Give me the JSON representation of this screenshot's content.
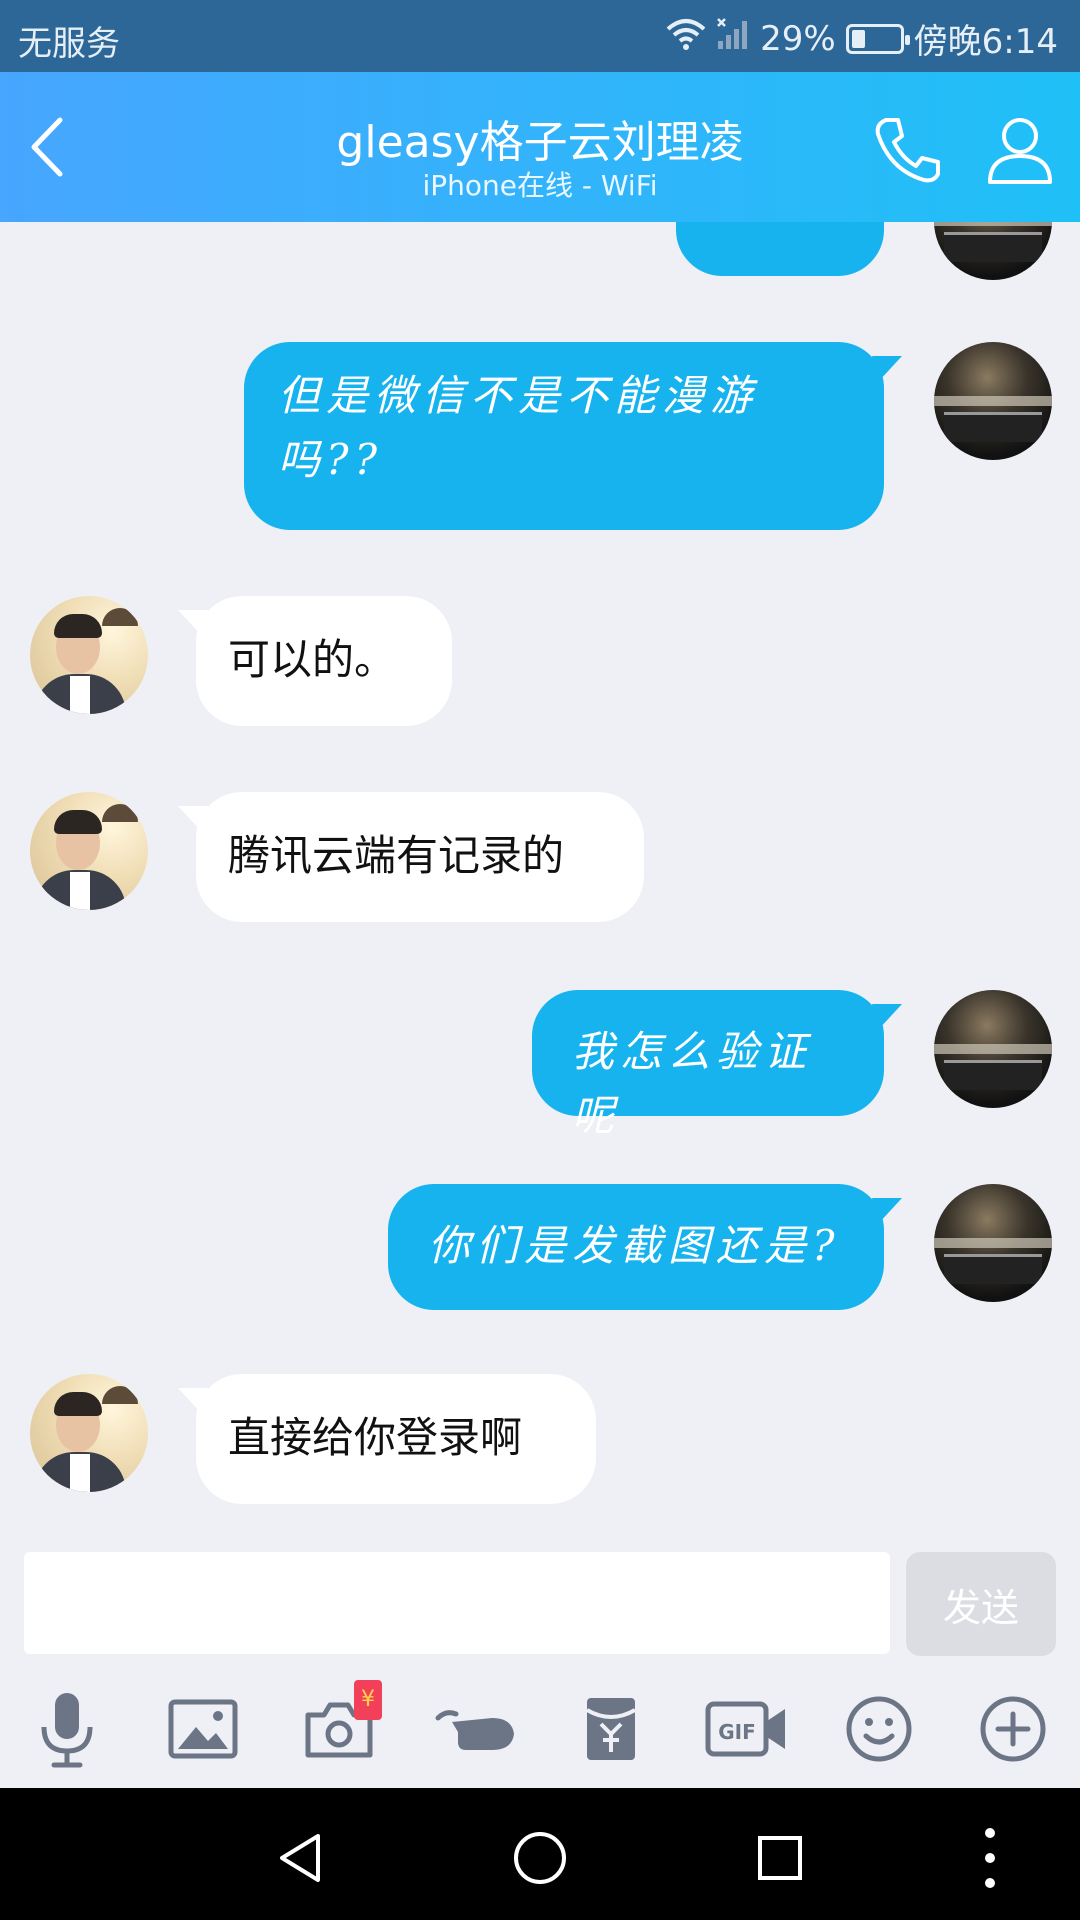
{
  "status_bar": {
    "carrier": "无服务",
    "battery_percent": "29%",
    "battery_level": 0.29,
    "time": "傍晚6:14"
  },
  "header": {
    "title": "gleasy格子云刘理凌",
    "subtitle": "iPhone在线 - WiFi",
    "icons": [
      "back-arrow-icon",
      "phone-icon",
      "profile-icon"
    ]
  },
  "messages": [
    {
      "direction": "out",
      "text": ""
    },
    {
      "direction": "out",
      "text": "但是微信不是不能漫游吗??"
    },
    {
      "direction": "in",
      "text": "可以的。"
    },
    {
      "direction": "in",
      "text": "腾讯云端有记录的"
    },
    {
      "direction": "out",
      "text": "我怎么验证呢"
    },
    {
      "direction": "out",
      "text": "你们是发截图还是?"
    },
    {
      "direction": "in",
      "text": "直接给你登录啊"
    }
  ],
  "composer": {
    "input_value": "",
    "send_label": "发送"
  },
  "toolbar": {
    "items": [
      "microphone-icon",
      "image-icon",
      "camera-icon",
      "poke-icon",
      "red-packet-icon",
      "gif-icon",
      "emoji-icon",
      "plus-icon"
    ],
    "camera_badge": "¥"
  },
  "navbar": {
    "items": [
      "back-triangle-icon",
      "home-circle-icon",
      "recents-square-icon",
      "more-dots-icon"
    ]
  },
  "colors": {
    "header_start": "#47a6ff",
    "header_end": "#1fc0f7",
    "outgoing_bubble": "#16b3ef",
    "incoming_bubble": "#ffffff",
    "background": "#eff0f6"
  }
}
